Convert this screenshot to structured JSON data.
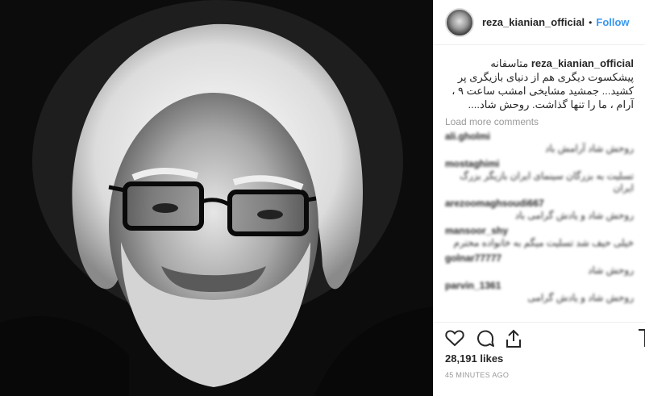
{
  "post": {
    "username": "reza_kianian_official",
    "separator": "•",
    "follow_label": "Follow",
    "caption_user": "reza_kianian_official",
    "caption_text": "متاسفانه پیشکسوت دیگری هم از دنیای بازیگری پر کشید... جمشید مشایخی امشب ساعت ۹ ، آرام ، ما را تنها گذاشت. روحش شاد....",
    "load_more": "Load more comments",
    "comments": [
      {
        "user": "ali.gholmi",
        "text": "روحش شاد آرامش باد"
      },
      {
        "user": "mostaghimi",
        "text": "تسلیت به بزرگان سینمای ایران بازیگر بزرگ ایران"
      },
      {
        "user": "arezoomaghsoudi667",
        "text": "روحش شاد و یادش گرامی باد"
      },
      {
        "user": "mansoor_shy",
        "text": "خیلی حیف شد تسلیت میگم به خانواده محترم"
      },
      {
        "user": "golnar77777",
        "text": "روحش شاد"
      },
      {
        "user": "parvin_1361",
        "text": "روحش شاد و یادش گرامی"
      }
    ],
    "likes": "28,191 likes",
    "time": "45 MINUTES AGO"
  },
  "icons": {
    "like": "heart-icon",
    "comment": "comment-icon",
    "share": "share-icon",
    "save": "bookmark-icon"
  }
}
